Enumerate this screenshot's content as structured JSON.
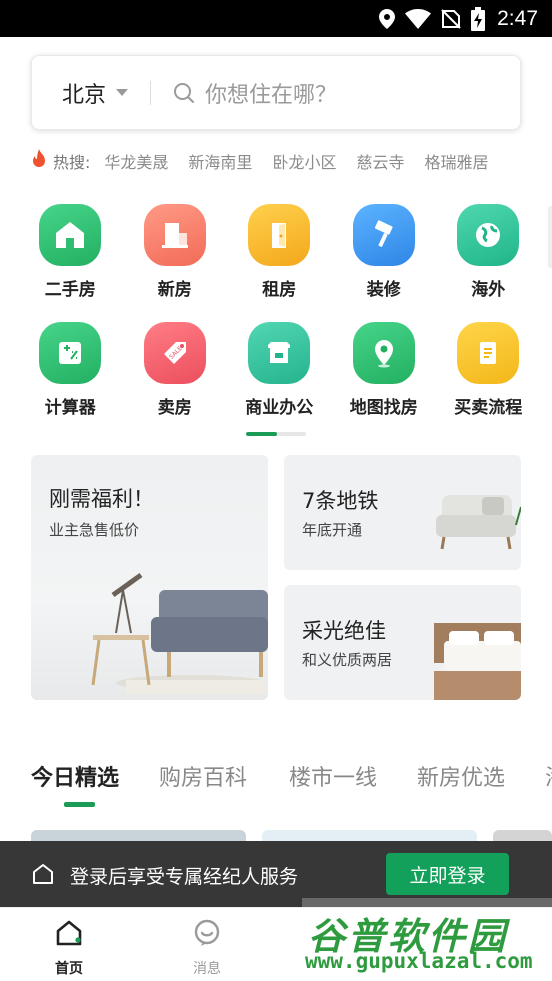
{
  "status_bar": {
    "time": "2:47",
    "icons": [
      "location-icon",
      "wifi-icon",
      "no-sim-icon",
      "battery-charging-icon"
    ]
  },
  "search": {
    "city": "北京",
    "placeholder": "你想住在哪？"
  },
  "hot_search": {
    "label": "热搜:",
    "items": [
      "华龙美晟",
      "新海南里",
      "卧龙小区",
      "慈云寺",
      "格瑞雅居"
    ]
  },
  "categories": {
    "row1": [
      {
        "label": "二手房",
        "icon": "house-icon",
        "color": "#2fbf72"
      },
      {
        "label": "新房",
        "icon": "building-icon",
        "color": "#f57c6a"
      },
      {
        "label": "租房",
        "icon": "door-icon",
        "color": "#f5b830"
      },
      {
        "label": "装修",
        "icon": "paint-brush-icon",
        "color": "#3d9af0"
      },
      {
        "label": "海外",
        "icon": "globe-icon",
        "color": "#2ec49c"
      }
    ],
    "row2": [
      {
        "label": "计算器",
        "icon": "calculator-icon",
        "color": "#2fbf72"
      },
      {
        "label": "卖房",
        "icon": "sale-tag-icon",
        "color": "#f25e6b"
      },
      {
        "label": "商业办公",
        "icon": "shop-icon",
        "color": "#34c7a2"
      },
      {
        "label": "地图找房",
        "icon": "map-pin-icon",
        "color": "#2fbf72"
      },
      {
        "label": "买卖流程",
        "icon": "document-icon",
        "color": "#f7c325"
      }
    ]
  },
  "promos": {
    "big": {
      "title": "刚需福利！",
      "subtitle": "业主急售低价"
    },
    "small1": {
      "title": "7条地铁",
      "subtitle": "年底开通"
    },
    "small2": {
      "title": "采光绝佳",
      "subtitle": "和义优质两居"
    }
  },
  "tabs": [
    "今日精选",
    "购房百科",
    "楼市一线",
    "新房优选",
    "海"
  ],
  "login_banner": {
    "text": "登录后享受专属经纪人服务",
    "button": "立即登录"
  },
  "bottom_nav": [
    {
      "label": "首页",
      "icon": "home-icon",
      "active": true
    },
    {
      "label": "消息",
      "icon": "message-icon",
      "active": false
    }
  ],
  "watermark": {
    "title": "谷普软件园",
    "url": "www.gupuxlazal.com"
  },
  "colors": {
    "accent": "#1a9c57",
    "login_button": "#13a05a",
    "hot_icon": "#f0522d"
  }
}
